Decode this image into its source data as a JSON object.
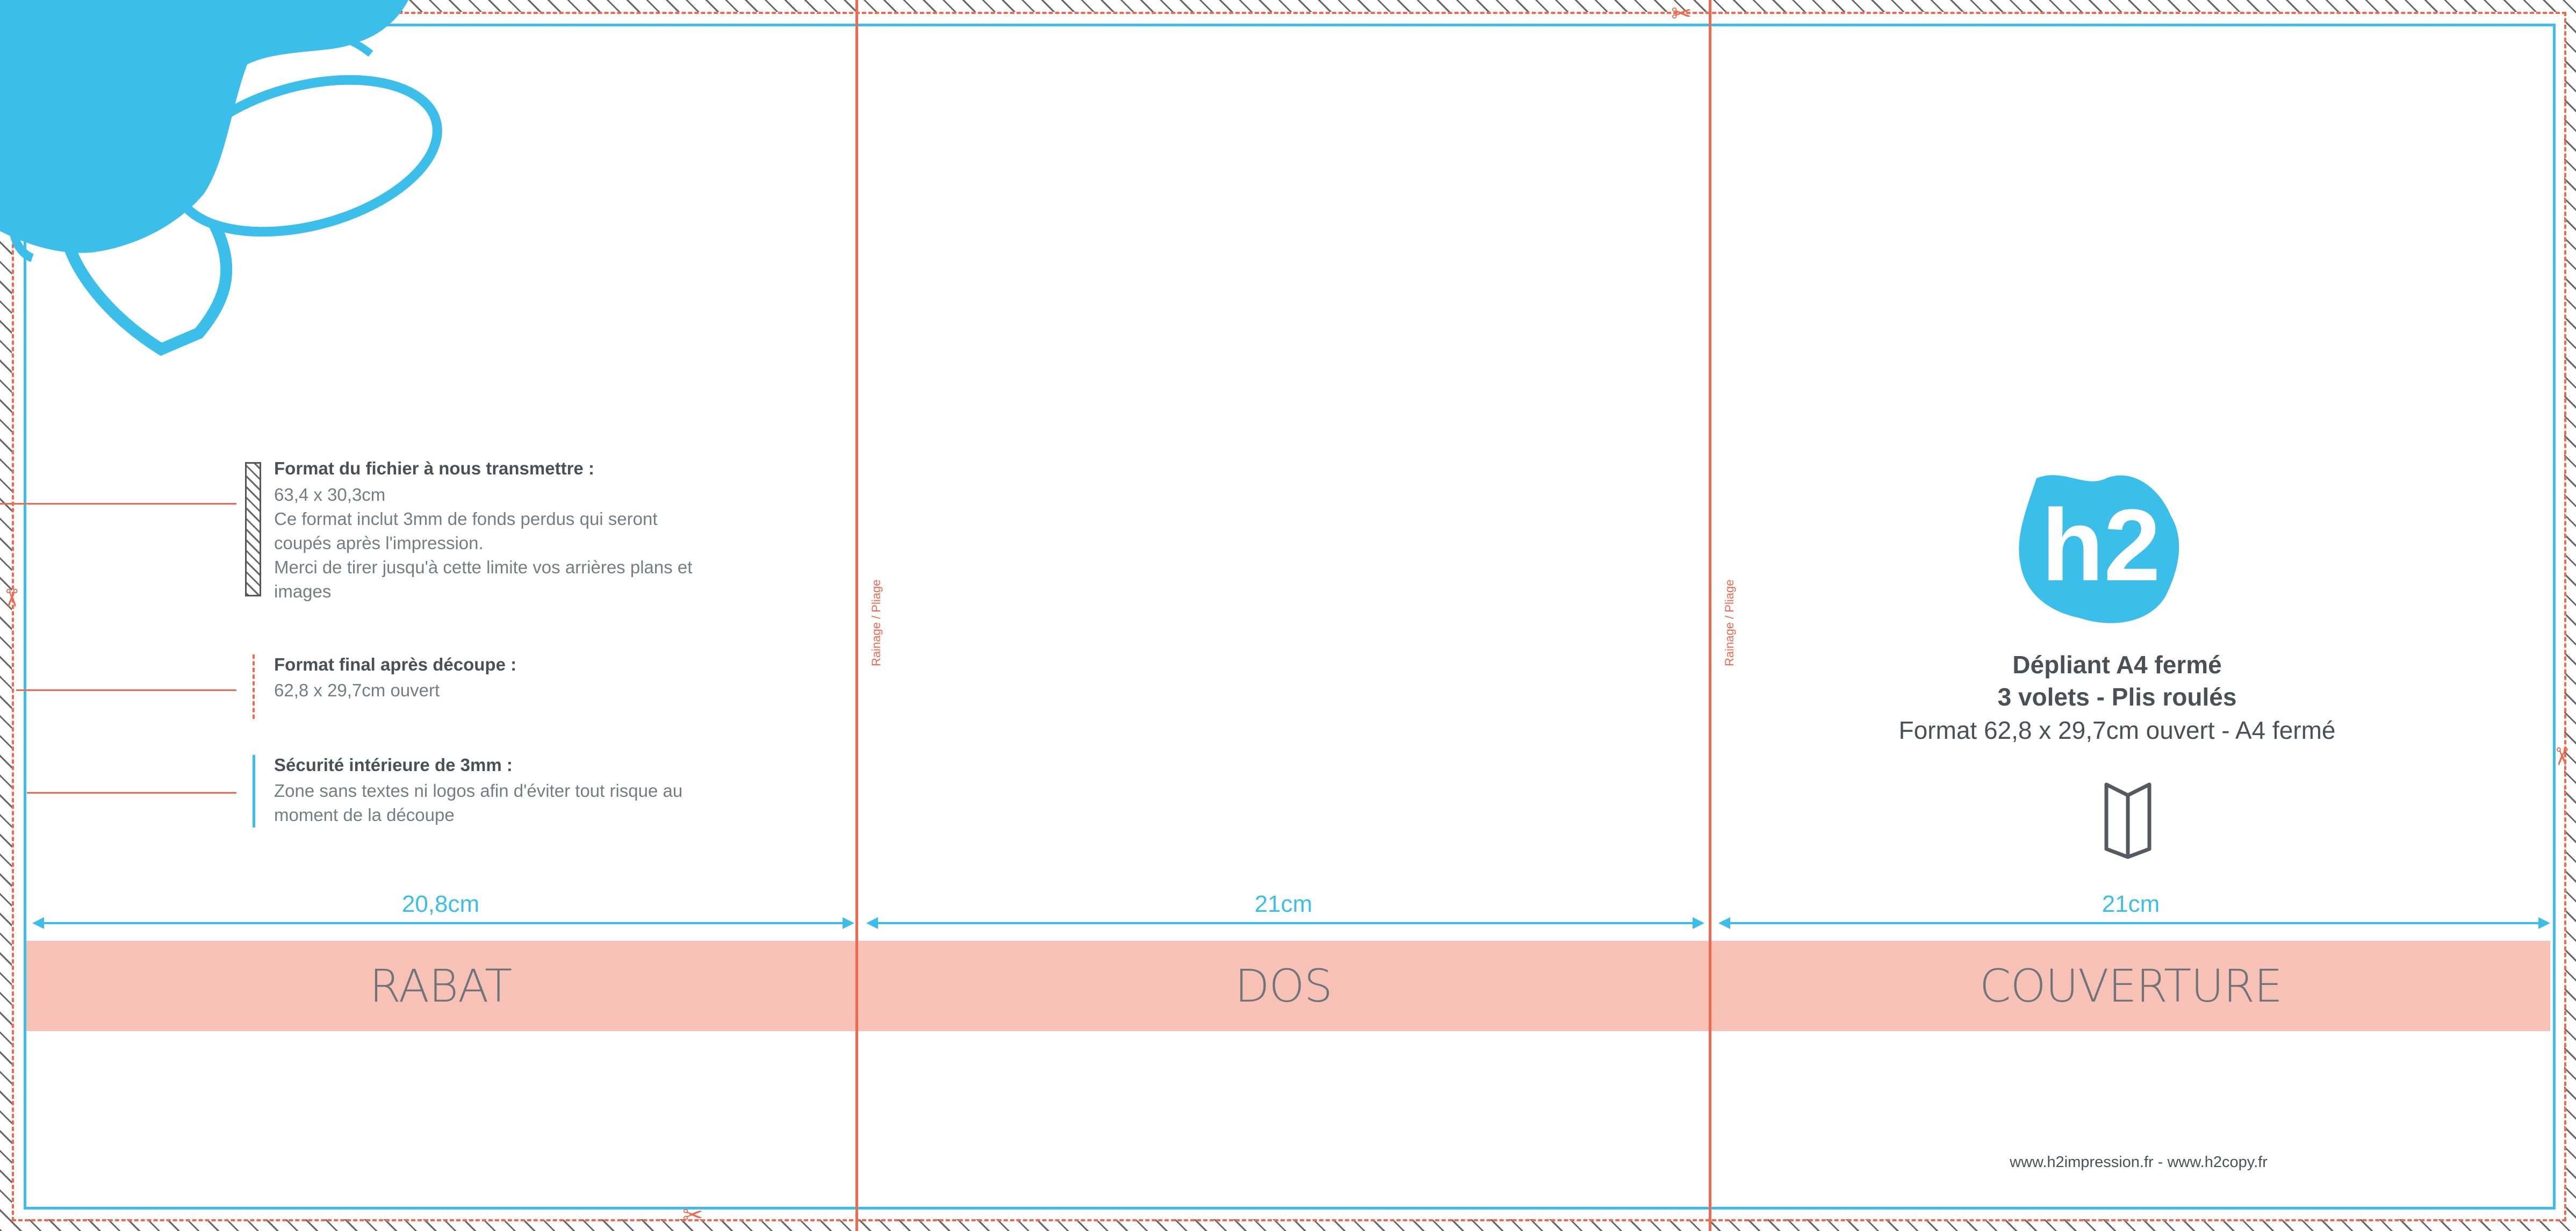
{
  "panels": {
    "rabat": "RABAT",
    "dos": "DOS",
    "couverture": "COUVERTURE"
  },
  "dimensions": {
    "rabat": "20,8cm",
    "dos": "21cm",
    "couverture": "21cm"
  },
  "fold_label": "Rainage / Pliage",
  "legend": {
    "bleed": {
      "title": "Format du fichier à nous transmettre :",
      "lines": [
        "63,4 x 30,3cm",
        "Ce format inclut 3mm de fonds perdus qui seront",
        "coupés après l'impression.",
        "Merci de tirer jusqu'à cette limite vos arrières plans et",
        "images"
      ]
    },
    "final": {
      "title": "Format final après découpe :",
      "lines": [
        "62,8 x 29,7cm ouvert"
      ]
    },
    "safety": {
      "title": "Sécurité intérieure de 3mm :",
      "lines": [
        "Zone sans textes ni logos afin d'éviter tout risque au",
        "moment de la découpe"
      ]
    }
  },
  "cover": {
    "logo_text": "h2",
    "title_line1": "Dépliant A4 fermé",
    "title_line2": "3 volets - Plis roulés",
    "subtitle": "Format 62,8 x 29,7cm ouvert - A4 fermé",
    "footer": "www.h2impression.fr - www.h2copy.fr"
  },
  "colors": {
    "cut_line": "#f0684e",
    "safety_line": "#3bbfea",
    "band": "#f7c2b5",
    "logo": "#3bbfea"
  },
  "icons": [
    "scissors-icon",
    "folded-leaflet-icon",
    "blue-splash-decoration"
  ]
}
